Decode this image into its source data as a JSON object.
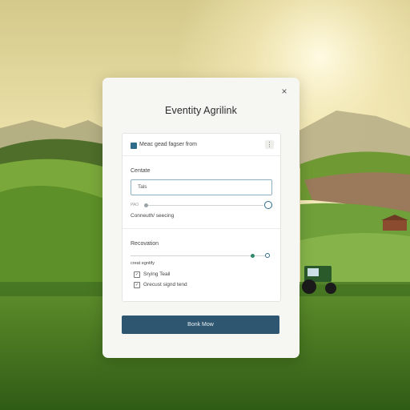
{
  "dialog": {
    "title": "Eventity Agrilink",
    "close_glyph": "×",
    "header_checkbox_label": "Meac gead fagser from",
    "kebab_glyph": "⋮",
    "section1": {
      "heading": "Centate",
      "input_value": "Tals",
      "slider_left_label": "PAO",
      "slider_value": 0.0,
      "slider_caption": "Conneuth/ seecing"
    },
    "section2": {
      "heading": "Recovation",
      "slider_value": 0.82,
      "slider_caption": "creat egntify",
      "checkboxes": [
        {
          "label": "Srying Teail",
          "checked": true
        },
        {
          "label": "Grecust signd tend",
          "checked": true
        }
      ]
    },
    "primary_button": "Bonk Mow"
  },
  "colors": {
    "accent": "#2e5670",
    "slider_active": "#2f8a6a",
    "field_border": "#8fb0c2"
  }
}
